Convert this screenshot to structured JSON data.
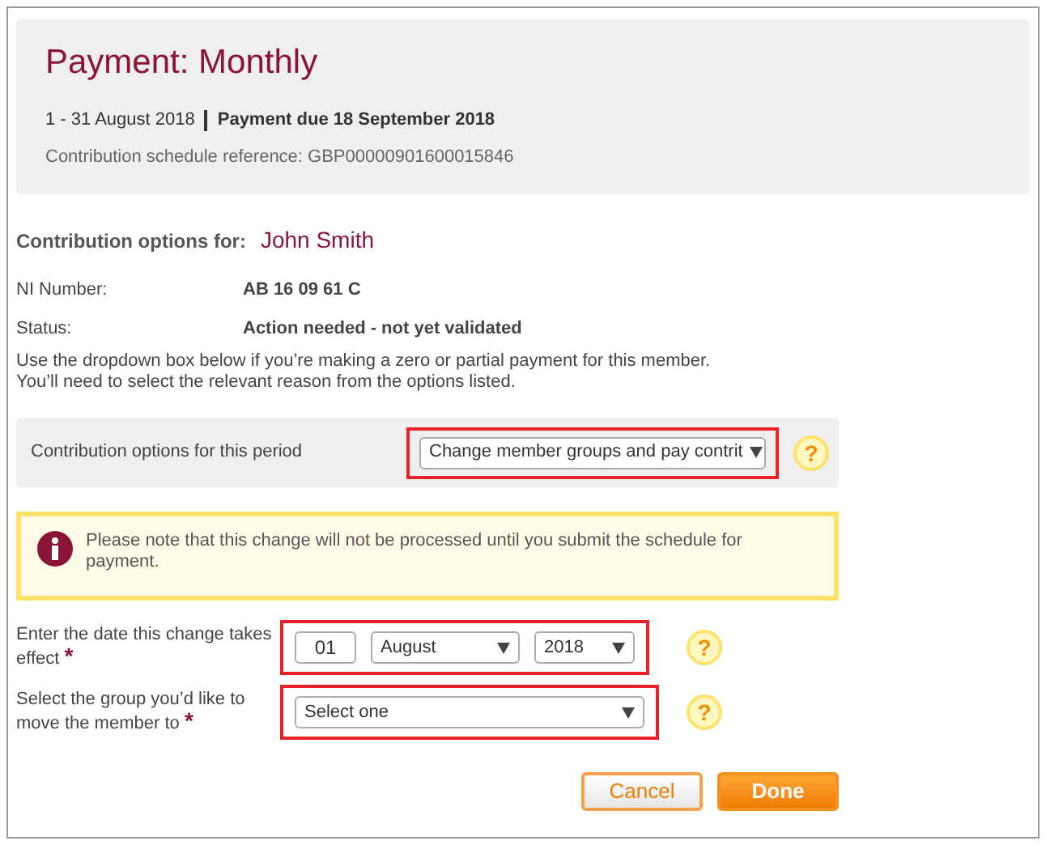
{
  "header": {
    "title": "Payment: Monthly",
    "period": "1 - 31 August 2018",
    "due": "Payment due 18 September 2018",
    "reference": "Contribution schedule reference: GBP00000901600015846"
  },
  "member": {
    "label": "Contribution options for:",
    "name": "John Smith"
  },
  "details": [
    {
      "label": "NI Number:",
      "value": "AB 16 09 61 C"
    },
    {
      "label": "Status:",
      "value": "Action needed - not yet validated"
    }
  ],
  "instructions": [
    "Use the dropdown box below if you’re making a zero or partial payment for this member.",
    "You’ll need to select the relevant reason from the options listed."
  ],
  "options": {
    "label": "Contribution options for this period",
    "value": "Change member groups and pay contrit",
    "help": "?"
  },
  "notice": "Please note that this change will not be processed until you submit the schedule for payment.",
  "date_row": {
    "label": "Enter the date this change takes effect",
    "required": "*",
    "day": "01",
    "month": "August",
    "year": "2018",
    "help": "?"
  },
  "group_row": {
    "label": "Select the group you’d like to move the member to",
    "required": "*",
    "value": "Select one",
    "help": "?"
  },
  "buttons": [
    {
      "label": "Cancel",
      "kind": "secondary"
    },
    {
      "label": "Done",
      "kind": "primary"
    }
  ]
}
